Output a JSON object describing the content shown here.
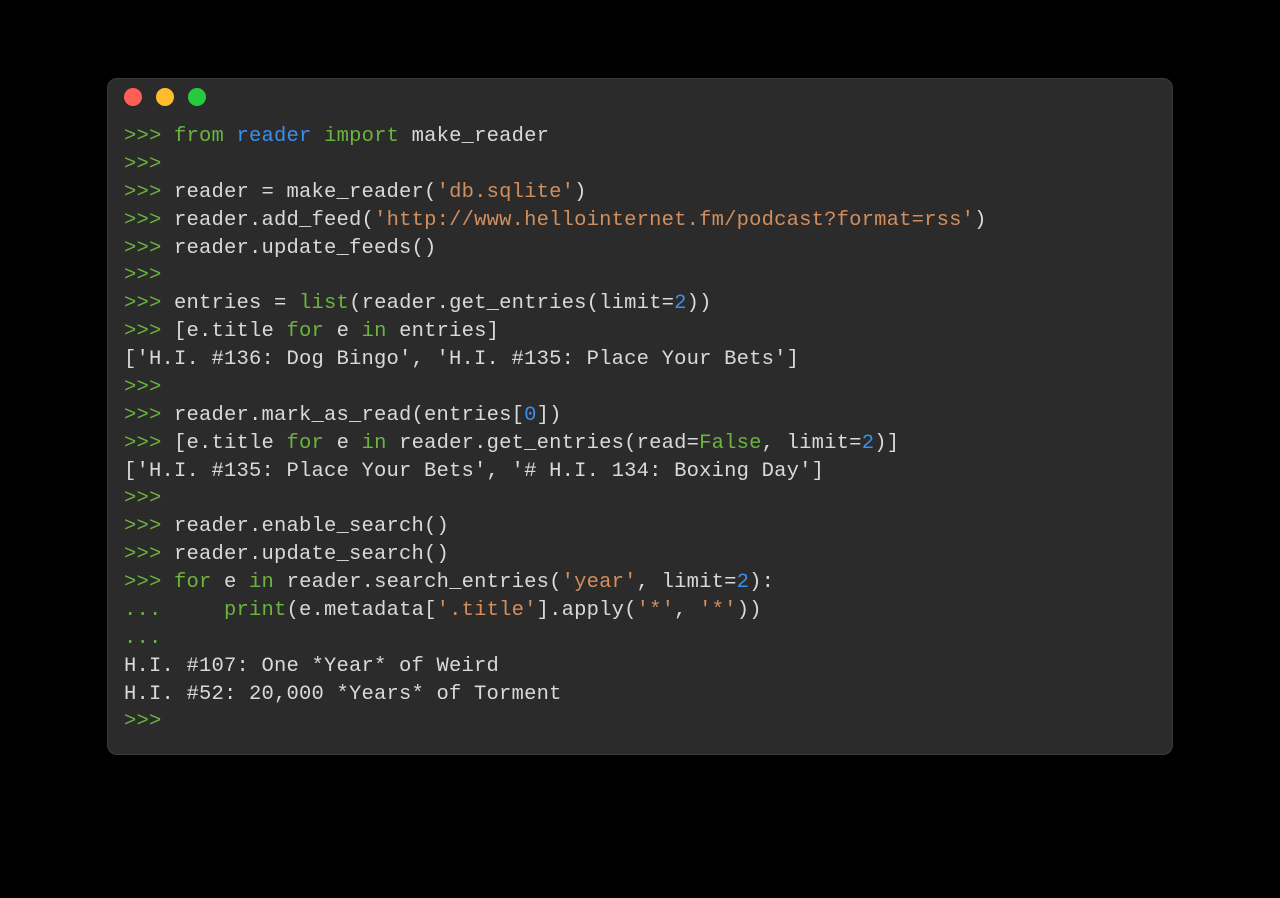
{
  "title_bar": {
    "buttons": [
      "close",
      "minimize",
      "zoom"
    ]
  },
  "colors": {
    "prompt": "#6cb33f",
    "keyword": "#6cb33f",
    "builtin": "#6cb33f",
    "module": "#3b8eea",
    "string": "#d28e5d",
    "number": "#3b8eea",
    "bool": "#6cb33f",
    "text": "#d9d9d9",
    "bg": "#2b2b2b"
  },
  "prompt_primary": ">>> ",
  "prompt_continuation": "... ",
  "lines": [
    {
      "type": "input",
      "tokens": [
        {
          "cls": "kw",
          "t": "from"
        },
        {
          "cls": "plain",
          "t": " "
        },
        {
          "cls": "module",
          "t": "reader"
        },
        {
          "cls": "plain",
          "t": " "
        },
        {
          "cls": "kw",
          "t": "import"
        },
        {
          "cls": "plain",
          "t": " make_reader"
        }
      ]
    },
    {
      "type": "input",
      "tokens": []
    },
    {
      "type": "input",
      "tokens": [
        {
          "cls": "plain",
          "t": "reader = make_reader("
        },
        {
          "cls": "str",
          "t": "'db.sqlite'"
        },
        {
          "cls": "plain",
          "t": ")"
        }
      ]
    },
    {
      "type": "input",
      "tokens": [
        {
          "cls": "plain",
          "t": "reader.add_feed("
        },
        {
          "cls": "str",
          "t": "'http://www.hellointernet.fm/podcast?format=rss'"
        },
        {
          "cls": "plain",
          "t": ")"
        }
      ]
    },
    {
      "type": "input",
      "tokens": [
        {
          "cls": "plain",
          "t": "reader.update_feeds()"
        }
      ]
    },
    {
      "type": "input",
      "tokens": []
    },
    {
      "type": "input",
      "tokens": [
        {
          "cls": "plain",
          "t": "entries = "
        },
        {
          "cls": "builtin",
          "t": "list"
        },
        {
          "cls": "plain",
          "t": "(reader.get_entries(limit="
        },
        {
          "cls": "num",
          "t": "2"
        },
        {
          "cls": "plain",
          "t": "))"
        }
      ]
    },
    {
      "type": "input",
      "tokens": [
        {
          "cls": "plain",
          "t": "[e.title "
        },
        {
          "cls": "kw",
          "t": "for"
        },
        {
          "cls": "plain",
          "t": " e "
        },
        {
          "cls": "kw",
          "t": "in"
        },
        {
          "cls": "plain",
          "t": " entries]"
        }
      ]
    },
    {
      "type": "output",
      "tokens": [
        {
          "cls": "plain",
          "t": "['H.I. #136: Dog Bingo', 'H.I. #135: Place Your Bets']"
        }
      ]
    },
    {
      "type": "input",
      "tokens": []
    },
    {
      "type": "input",
      "tokens": [
        {
          "cls": "plain",
          "t": "reader.mark_as_read(entries["
        },
        {
          "cls": "num",
          "t": "0"
        },
        {
          "cls": "plain",
          "t": "])"
        }
      ]
    },
    {
      "type": "input",
      "tokens": [
        {
          "cls": "plain",
          "t": "[e.title "
        },
        {
          "cls": "kw",
          "t": "for"
        },
        {
          "cls": "plain",
          "t": " e "
        },
        {
          "cls": "kw",
          "t": "in"
        },
        {
          "cls": "plain",
          "t": " reader.get_entries(read="
        },
        {
          "cls": "bool",
          "t": "False"
        },
        {
          "cls": "plain",
          "t": ", limit="
        },
        {
          "cls": "num",
          "t": "2"
        },
        {
          "cls": "plain",
          "t": ")]"
        }
      ]
    },
    {
      "type": "output",
      "tokens": [
        {
          "cls": "plain",
          "t": "['H.I. #135: Place Your Bets', '# H.I. 134: Boxing Day']"
        }
      ]
    },
    {
      "type": "input",
      "tokens": []
    },
    {
      "type": "input",
      "tokens": [
        {
          "cls": "plain",
          "t": "reader.enable_search()"
        }
      ]
    },
    {
      "type": "input",
      "tokens": [
        {
          "cls": "plain",
          "t": "reader.update_search()"
        }
      ]
    },
    {
      "type": "input",
      "tokens": [
        {
          "cls": "kw",
          "t": "for"
        },
        {
          "cls": "plain",
          "t": " e "
        },
        {
          "cls": "kw",
          "t": "in"
        },
        {
          "cls": "plain",
          "t": " reader.search_entries("
        },
        {
          "cls": "str",
          "t": "'year'"
        },
        {
          "cls": "plain",
          "t": ", limit="
        },
        {
          "cls": "num",
          "t": "2"
        },
        {
          "cls": "plain",
          "t": "):"
        }
      ]
    },
    {
      "type": "cont",
      "tokens": [
        {
          "cls": "plain",
          "t": "    "
        },
        {
          "cls": "builtin",
          "t": "print"
        },
        {
          "cls": "plain",
          "t": "(e.metadata["
        },
        {
          "cls": "str",
          "t": "'.title'"
        },
        {
          "cls": "plain",
          "t": "].apply("
        },
        {
          "cls": "str",
          "t": "'*'"
        },
        {
          "cls": "plain",
          "t": ", "
        },
        {
          "cls": "str",
          "t": "'*'"
        },
        {
          "cls": "plain",
          "t": "))"
        }
      ]
    },
    {
      "type": "cont",
      "tokens": []
    },
    {
      "type": "output",
      "tokens": [
        {
          "cls": "plain",
          "t": "H.I. #107: One *Year* of Weird"
        }
      ]
    },
    {
      "type": "output",
      "tokens": [
        {
          "cls": "plain",
          "t": "H.I. #52: 20,000 *Years* of Torment"
        }
      ]
    },
    {
      "type": "input",
      "tokens": []
    }
  ]
}
